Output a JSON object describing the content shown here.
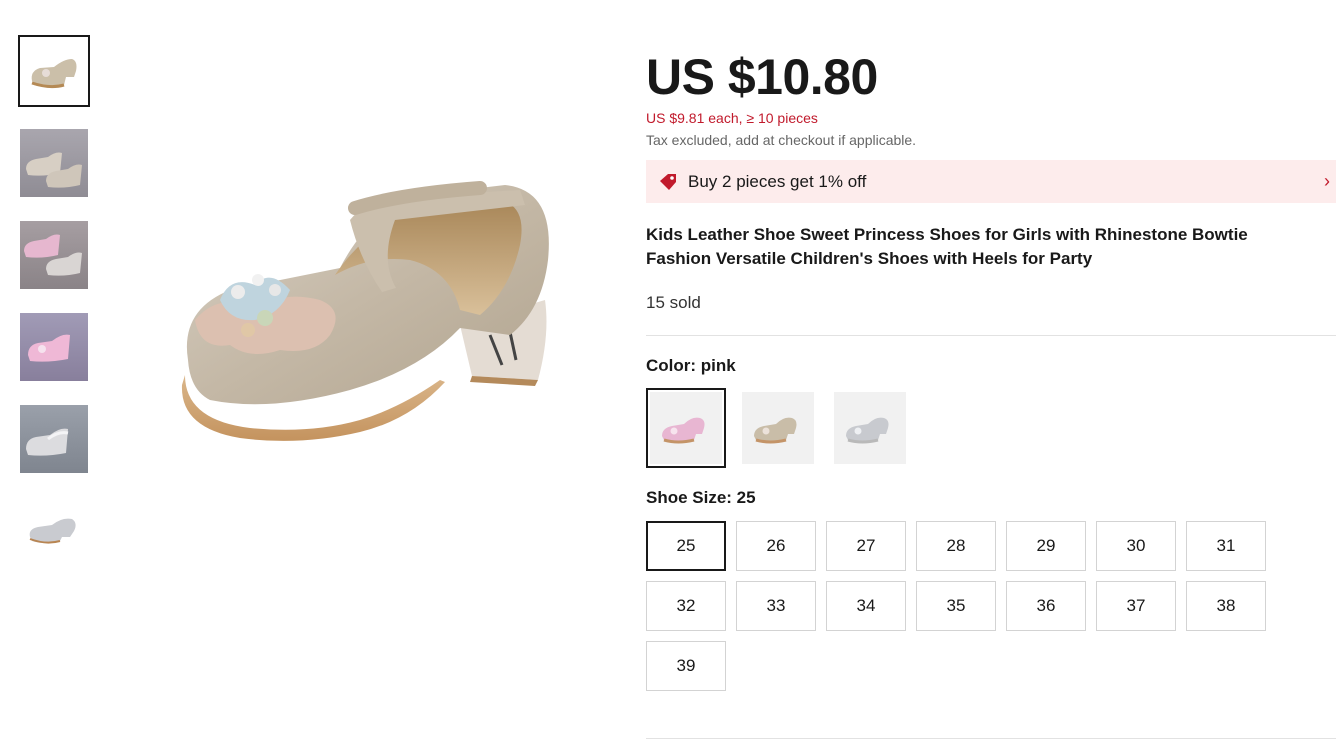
{
  "thumbnails": [
    {
      "icon": "silver-shoe-thumbnail",
      "active": true
    },
    {
      "icon": "shoes-photo-thumbnail"
    },
    {
      "icon": "pink-shoes-photo-thumbnail"
    },
    {
      "icon": "pink-shoes-photo-thumbnail-2"
    },
    {
      "icon": "silver-shoes-photo-thumbnail"
    },
    {
      "icon": "silver-shoe-thumbnail-2"
    }
  ],
  "product": {
    "price": "US $10.80",
    "bulk_price": "US $9.81 each, ≥ 10 pieces",
    "tax_note": "Tax excluded, add at checkout if applicable.",
    "promo": "Buy 2 pieces get 1% off",
    "title": "Kids Leather Shoe Sweet Princess Shoes for Girls with Rhinestone Bowtie Fashion Versatile Children's Shoes with Heels for Party",
    "sold": "15 sold"
  },
  "color": {
    "label": "Color: pink",
    "options": [
      "pink",
      "champagne",
      "silver"
    ],
    "selected": "pink"
  },
  "size": {
    "label": "Shoe Size: 25",
    "options": [
      "25",
      "26",
      "27",
      "28",
      "29",
      "30",
      "31",
      "32",
      "33",
      "34",
      "35",
      "36",
      "37",
      "38",
      "39"
    ],
    "selected": "25"
  },
  "colors": {
    "price_red": "#c11a2c",
    "promo_bg": "#fdecec",
    "border_dark": "#191919"
  }
}
